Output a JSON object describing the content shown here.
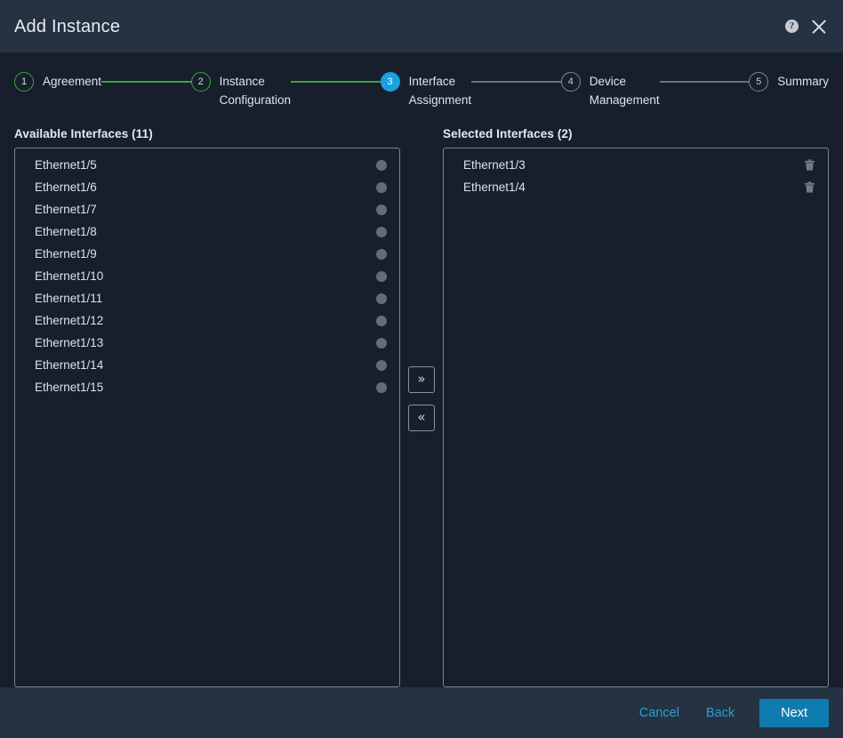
{
  "header": {
    "title": "Add Instance",
    "help_icon": "help-circle-icon",
    "help_glyph": "?",
    "close_icon": "close-icon"
  },
  "stepper": {
    "steps": [
      {
        "number": "1",
        "label": "Agreement",
        "state": "done"
      },
      {
        "number": "2",
        "label": "Instance\nConfiguration",
        "state": "done"
      },
      {
        "number": "3",
        "label": "Interface\nAssignment",
        "state": "active"
      },
      {
        "number": "4",
        "label": "Device\nManagement",
        "state": "pending"
      },
      {
        "number": "5",
        "label": "Summary",
        "state": "pending"
      }
    ],
    "connectors": [
      "green",
      "green",
      "gray",
      "gray"
    ]
  },
  "available": {
    "title": "Available Interfaces (11)",
    "count": 11,
    "items": [
      {
        "name": "Ethernet1/5"
      },
      {
        "name": "Ethernet1/6"
      },
      {
        "name": "Ethernet1/7"
      },
      {
        "name": "Ethernet1/8"
      },
      {
        "name": "Ethernet1/9"
      },
      {
        "name": "Ethernet1/10"
      },
      {
        "name": "Ethernet1/11"
      },
      {
        "name": "Ethernet1/12"
      },
      {
        "name": "Ethernet1/13"
      },
      {
        "name": "Ethernet1/14"
      },
      {
        "name": "Ethernet1/15"
      }
    ]
  },
  "selected": {
    "title": "Selected Interfaces (2)",
    "count": 2,
    "items": [
      {
        "name": "Ethernet1/3"
      },
      {
        "name": "Ethernet1/4"
      }
    ]
  },
  "transfer": {
    "move_right_label": "»",
    "move_left_label": "«",
    "move_right_icon": "chevron-double-right-icon",
    "move_left_icon": "chevron-double-left-icon"
  },
  "footer": {
    "cancel_label": "Cancel",
    "back_label": "Back",
    "next_label": "Next"
  },
  "colors": {
    "header_bg": "#253241",
    "body_bg": "#161f2b",
    "accent_blue": "#1ba0e0",
    "primary_button": "#0f7cb0",
    "link_blue": "#2b9fd8",
    "step_done_green": "#3fa33f",
    "status_dot_gray": "#636d78",
    "border_gray": "#7b858f"
  }
}
